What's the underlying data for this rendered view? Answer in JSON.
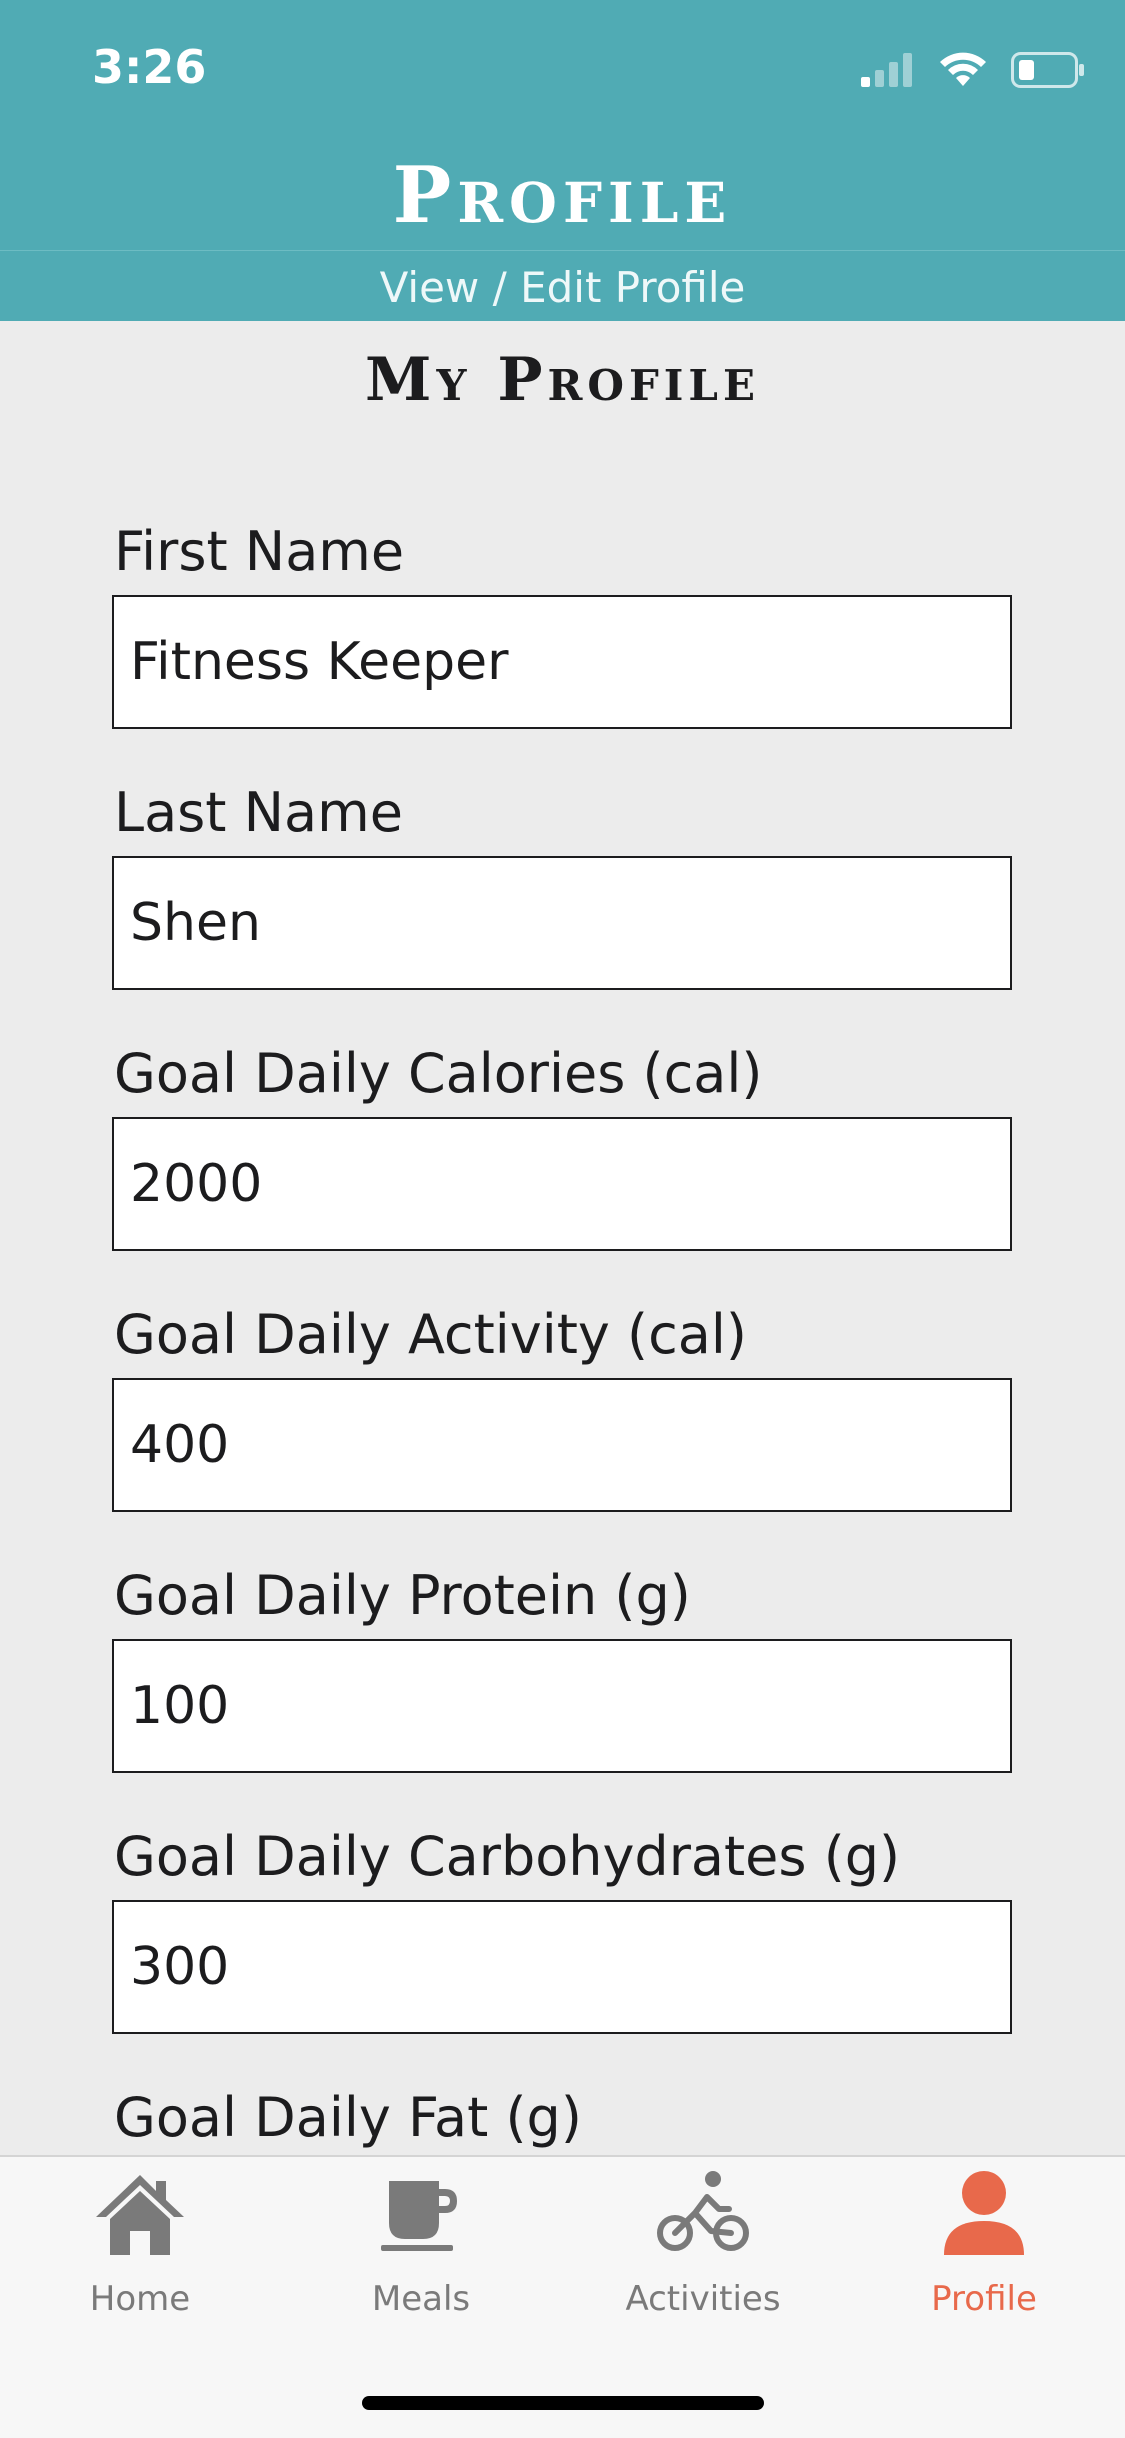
{
  "status_bar": {
    "time": "3:26"
  },
  "header": {
    "title": "Profile",
    "subtitle": "View / Edit Profile"
  },
  "page": {
    "title": "My Profile"
  },
  "form": {
    "fields": [
      {
        "label": "First Name",
        "value": "Fitness Keeper"
      },
      {
        "label": "Last Name",
        "value": "Shen"
      },
      {
        "label": "Goal Daily Calories (cal)",
        "value": "2000"
      },
      {
        "label": "Goal Daily Activity (cal)",
        "value": "400"
      },
      {
        "label": "Goal Daily Protein (g)",
        "value": "100"
      },
      {
        "label": "Goal Daily Carbohydrates (g)",
        "value": "300"
      },
      {
        "label": "Goal Daily Fat (g)",
        "value": ""
      }
    ]
  },
  "tab_bar": {
    "tabs": [
      {
        "label": "Home",
        "icon": "home-icon"
      },
      {
        "label": "Meals",
        "icon": "coffee-cup-icon"
      },
      {
        "label": "Activities",
        "icon": "bicycle-icon"
      },
      {
        "label": "Profile",
        "icon": "person-icon",
        "active": true
      }
    ]
  },
  "colors": {
    "header": "#50abb4",
    "active_tab": "#e8694b",
    "inactive_tab": "#7a7a7a",
    "background": "#ececec"
  }
}
